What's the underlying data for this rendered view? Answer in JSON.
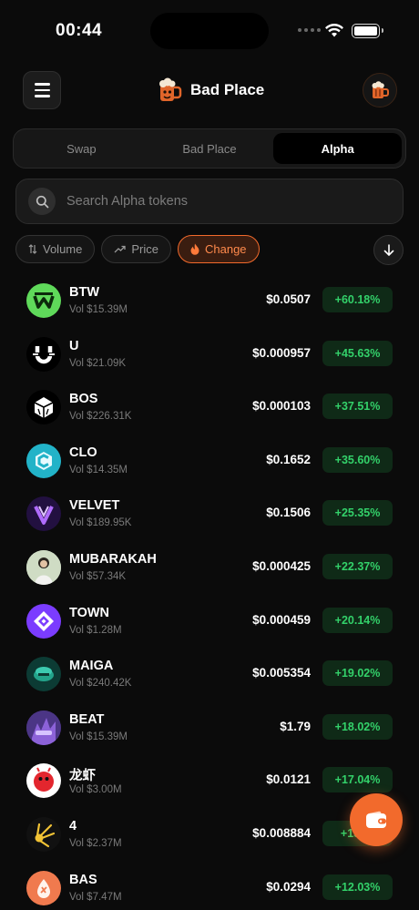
{
  "status_bar": {
    "time": "00:44"
  },
  "header": {
    "app_name": "Bad Place"
  },
  "tabs": [
    {
      "label": "Swap",
      "active": false
    },
    {
      "label": "Bad Place",
      "active": false
    },
    {
      "label": "Alpha",
      "active": true
    }
  ],
  "search": {
    "placeholder": "Search Alpha tokens",
    "value": ""
  },
  "filters": [
    {
      "label": "Volume",
      "icon": "sort-arrows-icon",
      "active": false
    },
    {
      "label": "Price",
      "icon": "trend-up-icon",
      "active": false
    },
    {
      "label": "Change",
      "icon": "flame-icon",
      "active": true
    }
  ],
  "sort": {
    "icon": "arrow-down-icon"
  },
  "tokens": [
    {
      "symbol": "BTW",
      "volume": "Vol $15.39M",
      "price": "$0.0507",
      "change": "+60.18%"
    },
    {
      "symbol": "U",
      "volume": "Vol $21.09K",
      "price": "$0.000957",
      "change": "+45.63%"
    },
    {
      "symbol": "BOS",
      "volume": "Vol $226.31K",
      "price": "$0.000103",
      "change": "+37.51%"
    },
    {
      "symbol": "CLO",
      "volume": "Vol $14.35M",
      "price": "$0.1652",
      "change": "+35.60%"
    },
    {
      "symbol": "VELVET",
      "volume": "Vol $189.95K",
      "price": "$0.1506",
      "change": "+25.35%"
    },
    {
      "symbol": "MUBARAKAH",
      "volume": "Vol $57.34K",
      "price": "$0.000425",
      "change": "+22.37%"
    },
    {
      "symbol": "TOWN",
      "volume": "Vol $1.28M",
      "price": "$0.000459",
      "change": "+20.14%"
    },
    {
      "symbol": "MAIGA",
      "volume": "Vol $240.42K",
      "price": "$0.005354",
      "change": "+19.02%"
    },
    {
      "symbol": "BEAT",
      "volume": "Vol $15.39M",
      "price": "$1.79",
      "change": "+18.02%"
    },
    {
      "symbol": "龙虾",
      "volume": "Vol $3.00M",
      "price": "$0.0121",
      "change": "+17.04%"
    },
    {
      "symbol": "4",
      "volume": "Vol $2.37M",
      "price": "$0.008884",
      "change": "+15.…"
    },
    {
      "symbol": "BAS",
      "volume": "Vol $7.47M",
      "price": "$0.0294",
      "change": "+12.03%"
    }
  ],
  "colors": {
    "accent": "#f26a2c",
    "positive": "#33d16a",
    "background": "#0b0b0b"
  }
}
